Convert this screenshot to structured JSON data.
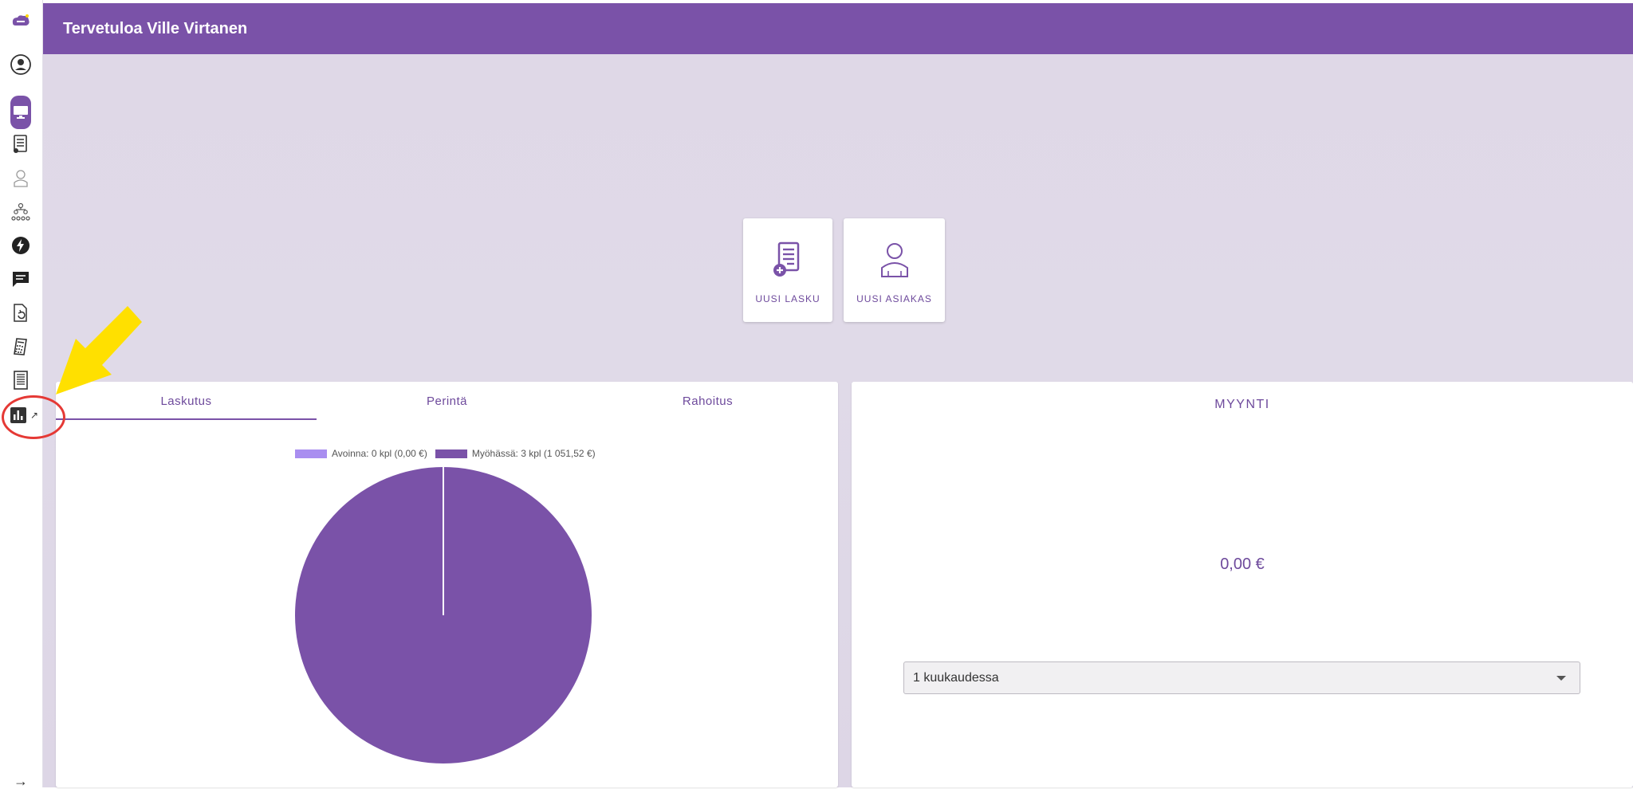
{
  "header": {
    "title": "Tervetuloa Ville Virtanen"
  },
  "sidebar": {
    "items": [
      {
        "name": "logo",
        "icon": "logo-icon"
      },
      {
        "name": "profile",
        "icon": "user-circle-icon"
      },
      {
        "name": "dashboard",
        "icon": "monitor-icon",
        "active": true
      },
      {
        "name": "invoices",
        "icon": "invoice-list-icon"
      },
      {
        "name": "customers",
        "icon": "person-icon"
      },
      {
        "name": "organization",
        "icon": "hierarchy-icon"
      },
      {
        "name": "quick",
        "icon": "lightning-icon"
      },
      {
        "name": "messages",
        "icon": "chat-icon"
      },
      {
        "name": "recurring",
        "icon": "document-refresh-icon"
      },
      {
        "name": "calculator",
        "icon": "calculator-icon"
      },
      {
        "name": "ledger",
        "icon": "ledger-icon"
      },
      {
        "name": "reports",
        "icon": "bar-chart-icon",
        "external": "↗"
      },
      {
        "name": "collapse",
        "icon": "arrow-right-icon",
        "glyph": "→"
      }
    ]
  },
  "actions": [
    {
      "label": "UUSI LASKU",
      "icon": "new-invoice-icon"
    },
    {
      "label": "UUSI ASIAKAS",
      "icon": "new-customer-icon"
    }
  ],
  "tabs": [
    {
      "label": "Laskutus",
      "active": true
    },
    {
      "label": "Perintä",
      "active": false
    },
    {
      "label": "Rahoitus",
      "active": false
    }
  ],
  "chart_data": {
    "type": "pie",
    "categories": [
      "Avoinna: 0 kpl (0,00 €)",
      "Myöhässä: 3 kpl (1 051,52 €)"
    ],
    "values": [
      0,
      1051.52
    ],
    "colors": [
      "#a98ef0",
      "#7a52a8"
    ],
    "legend": "top"
  },
  "sales": {
    "title": "MYYNTI",
    "value": "0,00 €",
    "period": "1 kuukaudessa"
  },
  "colors": {
    "primary": "#7a52a8",
    "accent_light": "#a98ef0",
    "annotation_arrow": "#ffe000",
    "annotation_circle": "#e53935"
  }
}
